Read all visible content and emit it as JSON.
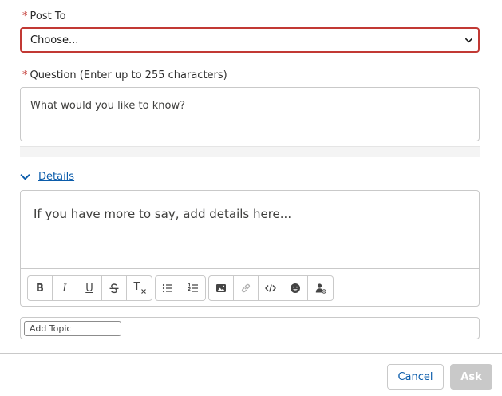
{
  "post_to": {
    "required_marker": "*",
    "label": "Post To",
    "selected": "Choose..."
  },
  "question": {
    "required_marker": "*",
    "label": "Question (Enter up to 255 characters)",
    "placeholder": "What would you like to know?"
  },
  "details": {
    "toggle_label": "Details",
    "placeholder": "If you have more to say, add details here...",
    "toolbar": {
      "bold": "B",
      "italic": "I",
      "underline": "U",
      "clear_format": "T"
    }
  },
  "topics": {
    "placeholder": "Add Topic"
  },
  "footer": {
    "cancel_label": "Cancel",
    "ask_label": "Ask"
  },
  "colors": {
    "required": "#c23934",
    "link": "#0b5cab",
    "border": "#c9c9c9",
    "disabled_button": "#c9c9c9"
  }
}
